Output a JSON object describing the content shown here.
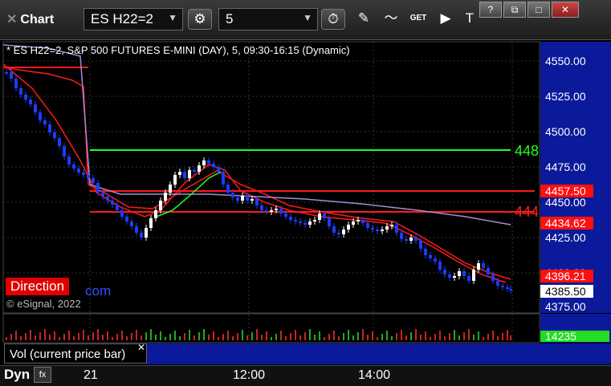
{
  "window": {
    "title": "Chart",
    "symbol": "ES H22=2",
    "interval": "5",
    "win_buttons": [
      "?",
      "⧉",
      "□",
      "✕"
    ]
  },
  "chart": {
    "subtitle": "* ES H22=2, S&P 500 FUTURES E-MINI (DAY), 5, 09:30-16:15 (Dynamic)",
    "direction_label": "Direction",
    "direction_tail": "com",
    "copyright": "© eSignal, 2022",
    "price_ticks": [
      "4550.00",
      "4525.00",
      "4500.00",
      "4475.00",
      "4450.00",
      "4425.00",
      "4400.00",
      "4375.00"
    ],
    "level_badges": [
      {
        "text": "4457.50",
        "color": "#ff1010"
      },
      {
        "text": "4434.62",
        "color": "#ff1010"
      },
      {
        "text": "4396.21",
        "color": "#ff1010"
      },
      {
        "text": "4385.50",
        "color": "#ffffff"
      }
    ],
    "line_labels": [
      {
        "text": "448",
        "color": "#22ff22"
      },
      {
        "text": "444",
        "color": "#ff2020"
      }
    ],
    "volume_badge": "14235"
  },
  "volume_panel": {
    "title": "Vol (current price bar)",
    "close_glyph": "✕"
  },
  "bottom": {
    "mode": "Dyn",
    "fx": "fx",
    "time_ticks": [
      "21",
      "12:00",
      "14:00"
    ]
  },
  "colors": {
    "up_candle": "#ffffff",
    "down_candle": "#1a3cff",
    "green_line": "#22ff22",
    "red_line": "#ff1a1a",
    "axis_bg": "#0a1a9a"
  }
}
